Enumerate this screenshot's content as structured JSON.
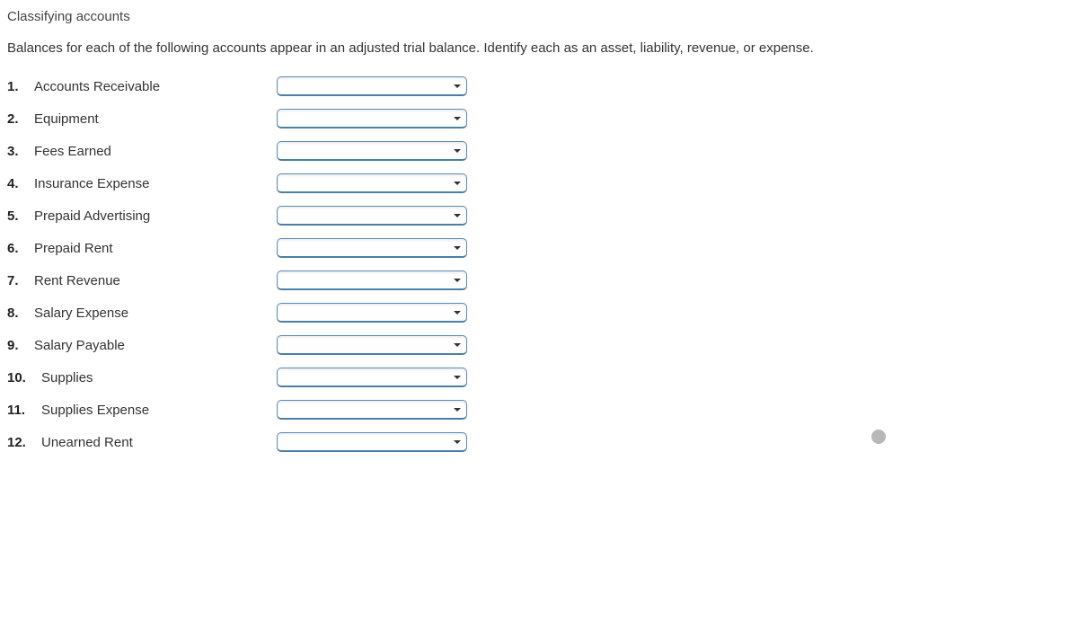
{
  "title": "Classifying accounts",
  "instructions": "Balances for each of the following accounts appear in an adjusted trial balance. Identify each as an asset, liability, revenue, or expense.",
  "items": [
    {
      "num": "1.",
      "label": "Accounts Receivable",
      "value": ""
    },
    {
      "num": "2.",
      "label": "Equipment",
      "value": ""
    },
    {
      "num": "3.",
      "label": "Fees Earned",
      "value": ""
    },
    {
      "num": "4.",
      "label": "Insurance Expense",
      "value": ""
    },
    {
      "num": "5.",
      "label": "Prepaid Advertising",
      "value": ""
    },
    {
      "num": "6.",
      "label": "Prepaid Rent",
      "value": ""
    },
    {
      "num": "7.",
      "label": "Rent Revenue",
      "value": ""
    },
    {
      "num": "8.",
      "label": "Salary Expense",
      "value": ""
    },
    {
      "num": "9.",
      "label": "Salary Payable",
      "value": ""
    },
    {
      "num": "10.",
      "label": "Supplies",
      "value": ""
    },
    {
      "num": "11.",
      "label": "Supplies Expense",
      "value": ""
    },
    {
      "num": "12.",
      "label": "Unearned Rent",
      "value": ""
    }
  ]
}
